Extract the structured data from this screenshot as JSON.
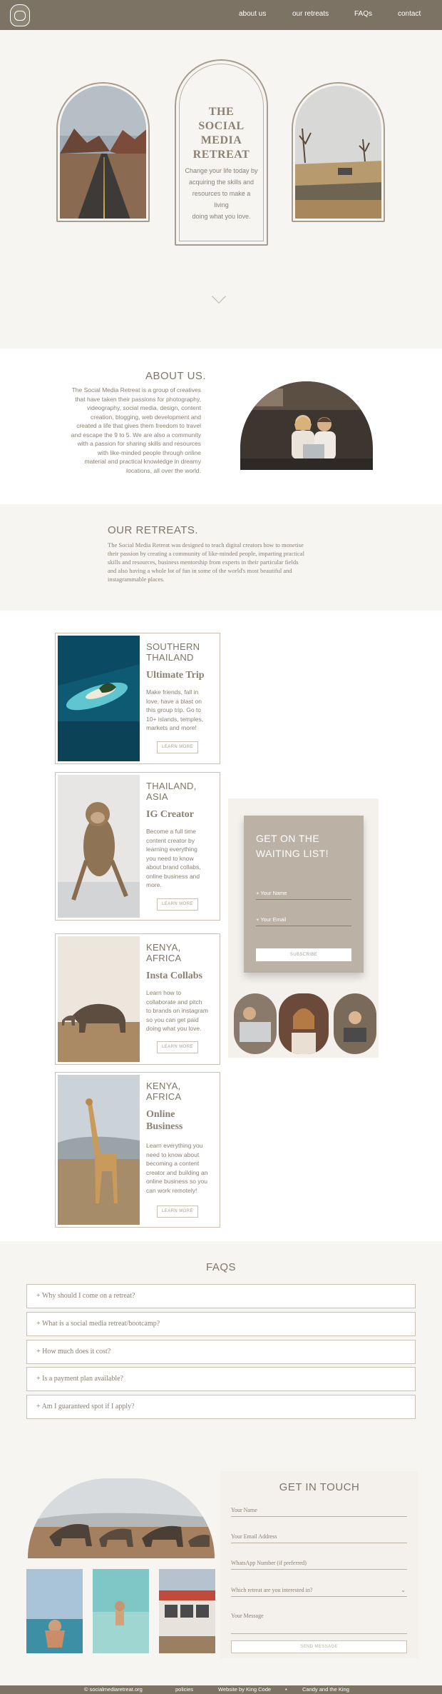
{
  "nav": {
    "links": [
      "about us",
      "our retreats",
      "FAQs",
      "contact"
    ]
  },
  "hero": {
    "title_lines": [
      "THE SOCIAL",
      "MEDIA",
      "RETREAT"
    ],
    "subtitle_lines": [
      "Change your life today by",
      "acquiring the skills and",
      "resources to make a living",
      "doing what you love."
    ]
  },
  "about": {
    "heading": "ABOUT US.",
    "lines": [
      "The Social Media Retreat is a group of creatives",
      "that have taken their passions for photography,",
      "videography, social media, design, content",
      "creation, blogging, web development and",
      "created a life that gives them freedom to travel",
      "and escape the 9 to 5. We are also a community",
      "with a passion for sharing skills and resources",
      "with like-minded people through online",
      "material and practical knowledge in dreamy",
      "locations, all over the world."
    ]
  },
  "retreats": {
    "heading": "OUR RETREATS.",
    "lines": [
      "The Social Media Retreat was designed to teach digital creators how to monetise",
      "their passion by creating a community of like-minded people, imparting practical",
      "skills and resources, business mentorship from experts in their particular fields",
      "and also having a whole lot of fun in some of the world's most beautiful and",
      "instagrammable places."
    ]
  },
  "cards": [
    {
      "location": [
        "SOUTHERN",
        "THAILAND"
      ],
      "name": [
        "Ultimate Trip"
      ],
      "desc": [
        "Make friends, fall in",
        "love, have a blast on",
        "this group trip. Go to",
        "10+ islands, temples,",
        "markets and more!"
      ],
      "button": "LEARN MORE"
    },
    {
      "location": [
        "THAILAND,",
        "ASIA"
      ],
      "name": [
        "IG Creator"
      ],
      "desc": [
        "Become a full time",
        "content creator by",
        "learning everything",
        "you need to know",
        "about brand collabs,",
        "online business and",
        "more."
      ],
      "button": "LEARN MORE"
    },
    {
      "location": [
        "KENYA,",
        "AFRICA"
      ],
      "name": [
        "Insta Collabs"
      ],
      "desc": [
        "Learn how to",
        "collaborate and pitch",
        "to brands on instagram",
        "so you can get paid",
        "doing what you love."
      ],
      "button": "LEARN MORE"
    },
    {
      "location": [
        "KENYA,",
        "AFRICA"
      ],
      "name": [
        "Online",
        "Business"
      ],
      "desc": [
        "Learn everything you",
        "need to know about",
        "becoming a content",
        "creator and building an",
        "online business so you",
        "can work remotely!"
      ],
      "button": "LEARN MORE"
    }
  ],
  "waiting": {
    "title_lines": [
      "GET ON THE",
      "WAITING LIST!"
    ],
    "name_placeholder": "Your Name",
    "email_placeholder": "Your Email",
    "button": "SUBSCRIBE"
  },
  "faqs": {
    "heading": "FAQS",
    "items": [
      "+ Why should I come on a retreat?",
      "+ What is a social media retreat/bootcamp?",
      "+ How much does it cost?",
      "+ Is a payment plan available?",
      "+ Am I guaranteed spot if I apply?"
    ]
  },
  "contact": {
    "heading": "GET IN TOUCH",
    "fields": [
      "Your Name",
      "Your Email Address",
      "WhatsApp Number (if preferred)",
      "Which retreat are you interested in?",
      "Your Message"
    ],
    "button": "SEND MESSAGE"
  },
  "footer": {
    "items": [
      "© socialmediaretreat.org",
      "policies",
      "Website by King Code",
      "Candy and the King"
    ]
  },
  "colors": {
    "nav": "#7c7365",
    "accent": "#bbb1a4",
    "border": "#c9c1b4"
  }
}
